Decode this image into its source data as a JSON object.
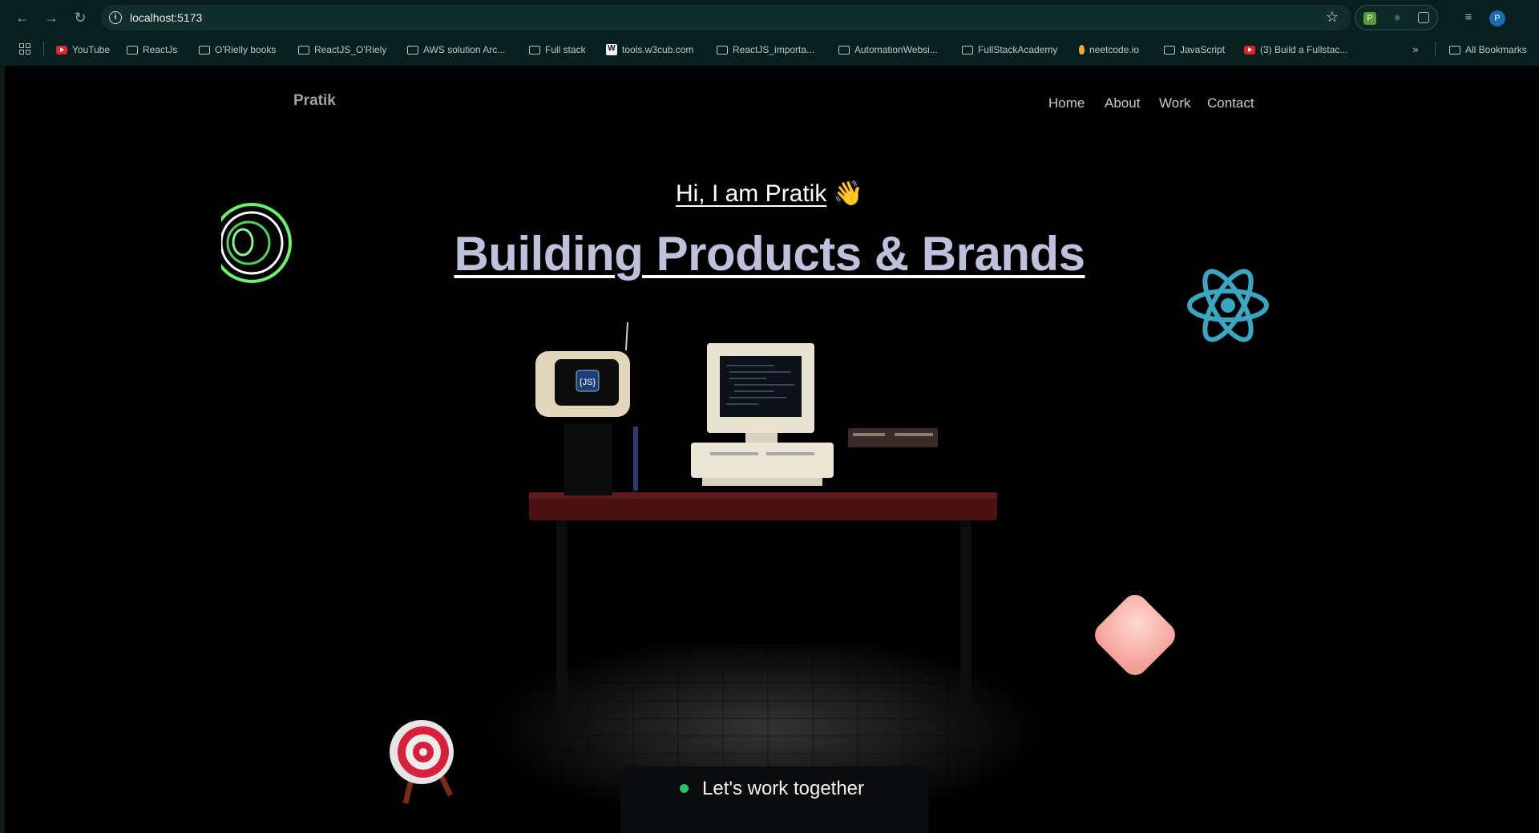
{
  "browser": {
    "url": "localhost:5173",
    "bookmarks": [
      {
        "label": "YouTube",
        "icon": "youtube-icon"
      },
      {
        "label": "ReactJs",
        "icon": "folder-icon"
      },
      {
        "label": "O'Rielly books",
        "icon": "folder-icon"
      },
      {
        "label": "ReactJS_O'Riely",
        "icon": "folder-icon"
      },
      {
        "label": "AWS solution Arc...",
        "icon": "folder-icon"
      },
      {
        "label": "Full stack",
        "icon": "folder-icon"
      },
      {
        "label": "tools.w3cub.com",
        "icon": "w3cub-icon"
      },
      {
        "label": "ReactJS_importa...",
        "icon": "folder-icon"
      },
      {
        "label": "AutomationWebsi...",
        "icon": "folder-icon"
      },
      {
        "label": "FullStackAcademy",
        "icon": "folder-icon"
      },
      {
        "label": "neetcode.io",
        "icon": "neetcode-icon"
      },
      {
        "label": "JavaScript",
        "icon": "folder-icon"
      },
      {
        "label": "(3) Build a Fullstac...",
        "icon": "youtube-icon"
      }
    ],
    "all_bookmarks_label": "All Bookmarks",
    "profile_initial": "P",
    "colors": {
      "chrome_bg": "#07201f",
      "omnibox_bg": "#0f2e2d"
    }
  },
  "site": {
    "logo": "Pratik",
    "nav": [
      "Home",
      "About",
      "Work",
      "Contact"
    ],
    "greeting": "Hi, I am Pratik",
    "greeting_emoji": "👋",
    "headline": "Building Products & Brands",
    "cta": "Let's work together",
    "colors": {
      "headline": "#bec0dc",
      "cta_dot": "#22c55e",
      "react": "#3aa6c0",
      "cube": "#f6b0a8"
    }
  }
}
